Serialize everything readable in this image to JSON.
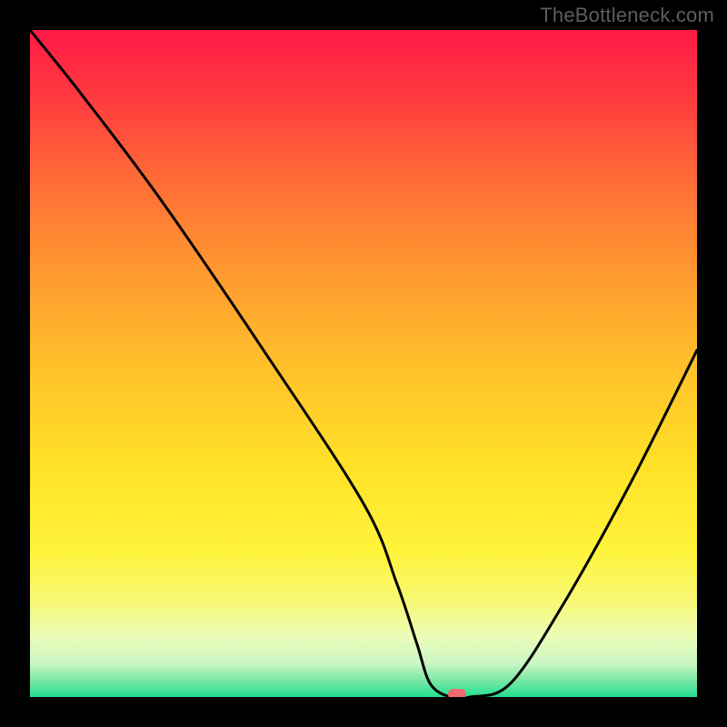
{
  "watermark": "TheBottleneck.com",
  "colors": {
    "frame_bg": "#000000",
    "watermark": "#5d5d5d",
    "curve_stroke": "#000000",
    "marker_fill": "#ef6a6f",
    "gradient_stops": [
      {
        "offset": 0.0,
        "color": "#ff1a47"
      },
      {
        "offset": 0.1,
        "color": "#ff3a3f"
      },
      {
        "offset": 0.22,
        "color": "#ff6a37"
      },
      {
        "offset": 0.35,
        "color": "#ff9530"
      },
      {
        "offset": 0.5,
        "color": "#ffbf2a"
      },
      {
        "offset": 0.65,
        "color": "#ffe127"
      },
      {
        "offset": 0.78,
        "color": "#fff33a"
      },
      {
        "offset": 0.86,
        "color": "#f7f978"
      },
      {
        "offset": 0.91,
        "color": "#ecfcb8"
      },
      {
        "offset": 0.95,
        "color": "#c9f6c3"
      },
      {
        "offset": 0.975,
        "color": "#7ae8a6"
      },
      {
        "offset": 1.0,
        "color": "#22df8f"
      }
    ]
  },
  "chart_data": {
    "type": "line",
    "title": "",
    "xlabel": "",
    "ylabel": "",
    "x_range": [
      0,
      100
    ],
    "y_range": [
      0,
      100
    ],
    "x": [
      0,
      8,
      20,
      35,
      50,
      55,
      58,
      60,
      63,
      66,
      72,
      80,
      90,
      100
    ],
    "values": [
      100,
      90,
      74,
      52,
      29,
      17,
      8,
      2,
      0,
      0,
      2,
      14,
      32,
      52
    ],
    "optimum_marker": {
      "x": 64,
      "y": 0
    },
    "annotations": []
  }
}
